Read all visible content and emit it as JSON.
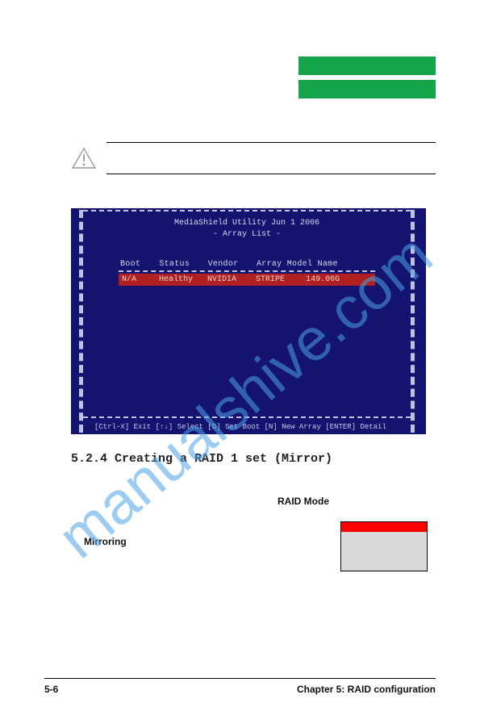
{
  "bios": {
    "title_line1": "MediaShield Utility   Jun  1 2006",
    "title_line2": "- Array List -",
    "columns": {
      "boot": "Boot",
      "status": "Status",
      "vendor": "Vendor",
      "model": "Array Model Name"
    },
    "row": {
      "boot": "N/A",
      "status": "Healthy",
      "vendor": "NVIDIA",
      "model": "STRIPE",
      "size": "149.06G"
    },
    "footer": "[Ctrl-X] Exit   [↑↓] Select   [D] Set Boot   [N] New Array   [ENTER] Detail"
  },
  "section": {
    "heading": "5.2.4   Creating a RAID 1 set (Mirror)",
    "raid_mode_label": "RAID Mode",
    "mirroring_label": "Mirroring"
  },
  "footer": {
    "left": "5-6",
    "right": "Chapter 5: RAID configuration"
  },
  "watermark_text": "manualshive.com",
  "colors": {
    "green": "#14a44a",
    "bios_bg": "#14136f",
    "bios_row": "#b02020",
    "red": "#ff0000",
    "gray_box": "#d9d9d9",
    "watermark": "#4aa3e8"
  }
}
